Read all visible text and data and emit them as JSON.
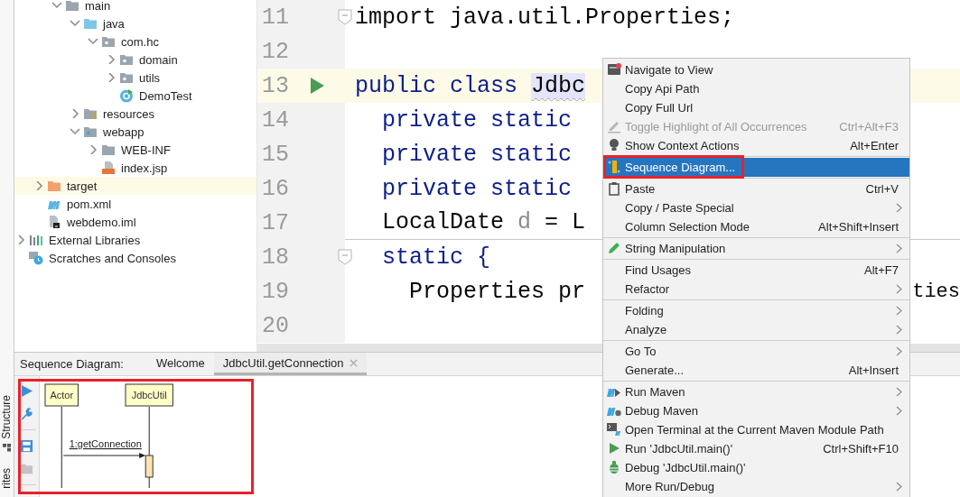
{
  "side_stripe": {
    "tabs": [
      {
        "label": "Structure",
        "kind": "structure"
      },
      {
        "label": "rites",
        "kind": "text"
      }
    ]
  },
  "project_tree": {
    "items": [
      {
        "children": [
          {
            "children": [
              {
                "label": "main",
                "kind": "folder",
                "expanded": true,
                "selected": false,
                "children": [
                  {
                    "label": "java",
                    "kind": "source",
                    "expanded": true,
                    "selected": false,
                    "children": [
                      {
                        "label": "com.hc",
                        "kind": "package",
                        "expanded": true,
                        "selected": false,
                        "children": [
                          {
                            "label": "domain",
                            "kind": "package",
                            "expanded": false,
                            "selected": false
                          },
                          {
                            "label": "utils",
                            "kind": "package",
                            "expanded": false,
                            "selected": false
                          },
                          {
                            "label": "DemoTest",
                            "kind": "class",
                            "selected": false
                          }
                        ]
                      }
                    ]
                  },
                  {
                    "label": "resources",
                    "kind": "resources",
                    "expanded": false,
                    "selected": false
                  },
                  {
                    "label": "webapp",
                    "kind": "web",
                    "expanded": true,
                    "selected": false,
                    "children": [
                      {
                        "label": "WEB-INF",
                        "kind": "folder",
                        "expanded": false,
                        "selected": false
                      },
                      {
                        "label": "index.jsp",
                        "kind": "jsp",
                        "selected": false
                      }
                    ]
                  }
                ]
              }
            ]
          },
          {
            "label": "target",
            "kind": "excluded",
            "expanded": false,
            "selected": true
          },
          {
            "label": "pom.xml",
            "kind": "maven",
            "selected": false
          },
          {
            "label": "webdemo.iml",
            "kind": "module",
            "selected": false
          }
        ]
      },
      {
        "label": "External Libraries",
        "kind": "libraries",
        "expanded": false,
        "selected": false
      },
      {
        "label": "Scratches and Consoles",
        "kind": "scratches",
        "selected": false
      }
    ]
  },
  "editor": {
    "lines": [
      {
        "number": "11",
        "kind": "fold",
        "current": false,
        "separator_after": false,
        "segments": [
          {
            "text": "import java.util.Properties;",
            "kind": "plain"
          }
        ]
      },
      {
        "number": "12",
        "kind": "plain",
        "current": false,
        "separator_after": false
      },
      {
        "number": "13",
        "kind": "run",
        "current": true,
        "separator_after": false,
        "segments": [
          {
            "text": "public class ",
            "kind": "keyword"
          },
          {
            "text": "Jdbc",
            "kind": "highlight"
          }
        ]
      },
      {
        "number": "14",
        "kind": "plain",
        "current": false,
        "separator_after": false,
        "segments": [
          {
            "text": "  private static",
            "kind": "keyword"
          }
        ]
      },
      {
        "number": "15",
        "kind": "plain",
        "current": false,
        "separator_after": false,
        "segments": [
          {
            "text": "  private static",
            "kind": "keyword"
          }
        ]
      },
      {
        "number": "16",
        "kind": "plain",
        "current": false,
        "separator_after": false,
        "segments": [
          {
            "text": "  private static",
            "kind": "keyword"
          }
        ]
      },
      {
        "number": "17",
        "kind": "plain",
        "current": false,
        "separator_after": true,
        "segments": [
          {
            "text": "  LocalDate ",
            "kind": "plain"
          },
          {
            "text": "d",
            "kind": "muted"
          },
          {
            "text": " = L",
            "kind": "plain"
          }
        ]
      },
      {
        "number": "18",
        "kind": "fold",
        "current": false,
        "separator_after": false,
        "segments": [
          {
            "text": "  static {",
            "kind": "keyword"
          }
        ]
      },
      {
        "number": "19",
        "kind": "plain",
        "current": false,
        "separator_after": false,
        "segments": [
          {
            "text": "    Properties pr",
            "kind": "plain"
          }
        ],
        "tail": "ties"
      },
      {
        "number": "20",
        "kind": "plain",
        "current": false,
        "separator_after": false
      }
    ]
  },
  "context_menu": {
    "groups": [
      {
        "items": [
          {
            "label": "Navigate to View",
            "kind": "navigate",
            "submenu": false,
            "disabled": false,
            "selected": false
          },
          {
            "label": "Copy Api Path",
            "kind": "text",
            "submenu": false,
            "disabled": false,
            "selected": false
          },
          {
            "label": "Copy Full Url",
            "kind": "text",
            "submenu": false,
            "disabled": false,
            "selected": false
          },
          {
            "label": "Toggle Highlight of All Occurrences",
            "shortcut": "Ctrl+Alt+F3",
            "kind": "highlighter",
            "submenu": false,
            "disabled": true,
            "selected": false
          },
          {
            "label": "Show Context Actions",
            "shortcut": "Alt+Enter",
            "kind": "bulb",
            "submenu": false,
            "disabled": false,
            "selected": false
          }
        ]
      },
      {
        "items": [
          {
            "label": "Sequence Diagram...",
            "kind": "sequence",
            "submenu": false,
            "disabled": false,
            "selected": true,
            "outlined": true
          }
        ]
      },
      {
        "items": [
          {
            "label": "Paste",
            "shortcut": "Ctrl+V",
            "kind": "clipboard",
            "submenu": false,
            "disabled": false,
            "selected": false
          },
          {
            "label": "Copy / Paste Special",
            "kind": "text",
            "submenu": true,
            "disabled": false,
            "selected": false
          },
          {
            "label": "Column Selection Mode",
            "shortcut": "Alt+Shift+Insert",
            "kind": "text",
            "submenu": false,
            "disabled": false,
            "selected": false
          }
        ]
      },
      {
        "items": [
          {
            "label": "String Manipulation",
            "kind": "pencil",
            "submenu": true,
            "disabled": false,
            "selected": false
          }
        ]
      },
      {
        "items": [
          {
            "label": "Find Usages",
            "shortcut": "Alt+F7",
            "kind": "text",
            "submenu": false,
            "disabled": false,
            "selected": false
          },
          {
            "label": "Refactor",
            "kind": "text",
            "submenu": true,
            "disabled": false,
            "selected": false
          }
        ]
      },
      {
        "items": [
          {
            "label": "Folding",
            "kind": "text",
            "submenu": true,
            "disabled": false,
            "selected": false
          },
          {
            "label": "Analyze",
            "kind": "text",
            "submenu": true,
            "disabled": false,
            "selected": false
          }
        ]
      },
      {
        "items": [
          {
            "label": "Go To",
            "kind": "text",
            "submenu": true,
            "disabled": false,
            "selected": false
          },
          {
            "label": "Generate...",
            "shortcut": "Alt+Insert",
            "kind": "text",
            "submenu": false,
            "disabled": false,
            "selected": false
          }
        ]
      },
      {
        "items": [
          {
            "label": "Run Maven",
            "kind": "maven-run",
            "submenu": true,
            "disabled": false,
            "selected": false
          },
          {
            "label": "Debug Maven",
            "kind": "maven-debug",
            "submenu": true,
            "disabled": false,
            "selected": false
          },
          {
            "label": "Open Terminal at the Current Maven Module Path",
            "kind": "terminal",
            "submenu": false,
            "disabled": false,
            "selected": false
          },
          {
            "label": "Run 'JdbcUtil.main()'",
            "shortcut": "Ctrl+Shift+F10",
            "kind": "run",
            "submenu": false,
            "disabled": false,
            "selected": false
          },
          {
            "label": "Debug 'JdbcUtil.main()'",
            "kind": "bug",
            "submenu": false,
            "disabled": false,
            "selected": false
          },
          {
            "label": "More Run/Debug",
            "kind": "text",
            "submenu": true,
            "disabled": false,
            "selected": false
          }
        ]
      }
    ]
  },
  "sequence_panel": {
    "title": "Sequence Diagram:",
    "outlined": true,
    "tabs": [
      {
        "label": "Welcome",
        "selected": false,
        "closable": false
      },
      {
        "label": "JdbcUtil.getConnection",
        "selected": true,
        "closable": true
      }
    ],
    "toolbar": [
      {
        "kind": "play",
        "disabled": false
      },
      {
        "kind": "wrench",
        "disabled": false
      },
      {
        "kind": "save",
        "disabled": false
      },
      {
        "kind": "folder",
        "disabled": true
      }
    ],
    "participants": [
      {
        "name": "Actor"
      },
      {
        "name": "JdbcUtil"
      }
    ],
    "messages": [
      {
        "label": "1:getConnection"
      }
    ]
  }
}
